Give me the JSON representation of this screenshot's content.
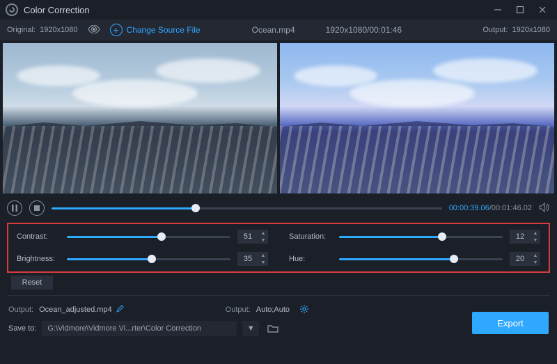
{
  "titlebar": {
    "title": "Color Correction"
  },
  "infobar": {
    "original_label": "Original:",
    "original_res": "1920x1080",
    "change_source": "Change Source File",
    "filename": "Ocean.mp4",
    "res_dur": "1920x1080/00:01:46",
    "output_label": "Output:",
    "output_res": "1920x1080"
  },
  "playback": {
    "current_time": "00:00:39.06",
    "total_time": "00:01:46.02",
    "progress_pct": 37
  },
  "sliders": {
    "contrast": {
      "label": "Contrast:",
      "value": 51,
      "pct": 58
    },
    "brightness": {
      "label": "Brightness:",
      "value": 35,
      "pct": 52
    },
    "saturation": {
      "label": "Saturation:",
      "value": 12,
      "pct": 63
    },
    "hue": {
      "label": "Hue:",
      "value": 20,
      "pct": 70
    }
  },
  "reset_label": "Reset",
  "output": {
    "file_label": "Output:",
    "file_value": "Ocean_adjusted.mp4",
    "fmt_label": "Output:",
    "fmt_value": "Auto;Auto"
  },
  "save": {
    "label": "Save to:",
    "path": "G:\\Vidmore\\Vidmore Vi...rter\\Color Correction"
  },
  "export_label": "Export"
}
